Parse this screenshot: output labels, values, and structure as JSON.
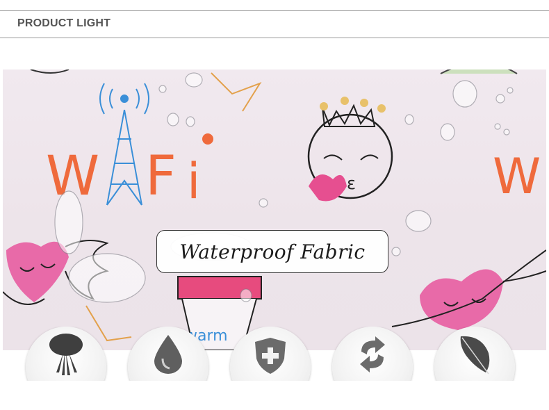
{
  "section": {
    "title": "PRODUCT LIGHT"
  },
  "banner": {
    "caption": "Waterproof Fabric",
    "print_text": {
      "wifi_left": "WiFi",
      "wifi_right": "W",
      "cup_text": "warm"
    }
  },
  "features": [
    {
      "icon": "feather-duster-icon"
    },
    {
      "icon": "water-drop-icon"
    },
    {
      "icon": "shield-plus-icon"
    },
    {
      "icon": "recycle-arrows-icon"
    },
    {
      "icon": "feather-icon"
    }
  ],
  "colors": {
    "rule": "#9a9a9a",
    "title": "#555555",
    "fabric": "#efe7ed",
    "heart_pink": "#e64f90",
    "wifi_orange": "#ef6a3c",
    "tower_blue": "#3a8fd8",
    "icon_gray": "#6b6b6b"
  }
}
